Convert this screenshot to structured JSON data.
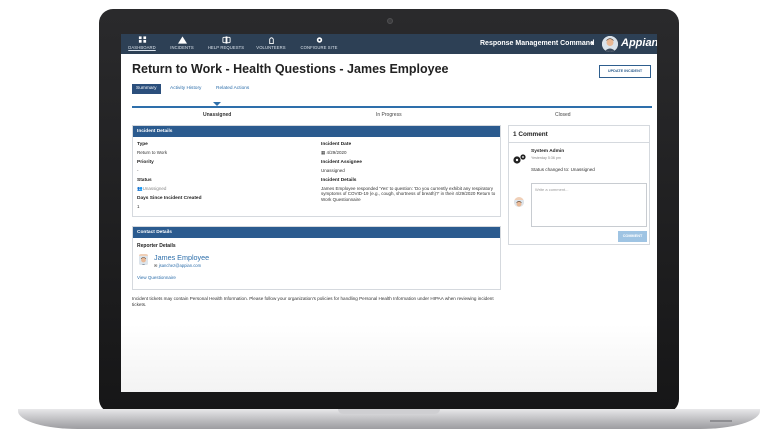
{
  "nav": {
    "items": [
      {
        "label": "DASHBOARD",
        "icon": "dashboard-icon"
      },
      {
        "label": "INCIDENTS",
        "icon": "warning-icon"
      },
      {
        "label": "HELP REQUESTS",
        "icon": "help-request-icon"
      },
      {
        "label": "VOLUNTEERS",
        "icon": "volunteer-icon"
      },
      {
        "label": "CONFIGURE SITE",
        "icon": "gear-icon"
      }
    ],
    "app_name": "Response Management Command",
    "logo": "Appian"
  },
  "header": {
    "title": "Return to Work - Health Questions - James Employee",
    "update_button": "UPDATE INCIDENT",
    "tabs": [
      "Summary",
      "Activity History",
      "Related Actions"
    ]
  },
  "status": {
    "steps": [
      "Unassigned",
      "In Progress",
      "Closed"
    ],
    "current": "Unassigned"
  },
  "incident_details": {
    "heading": "Incident Details",
    "type_label": "Type",
    "type_value": "Return to Work",
    "priority_label": "Priority",
    "priority_value": "-",
    "status_label": "Status",
    "status_value": "Unassigned",
    "days_label": "Days Since Incident Created",
    "days_value": "1",
    "date_label": "Incident Date",
    "date_value": "4/29/2020",
    "assignee_label": "Incident Assignee",
    "assignee_value": "Unassigned",
    "details_label": "Incident Details",
    "details_value": "James Employee responded 'Yes' to question: 'Do you currently exhibit any respiratory symptoms of COVID-19 (e.g., cough, shortness of breath)?' in their 4/29/2020 Return to Work Questionnaire"
  },
  "contact_details": {
    "heading": "Contact Details",
    "reporter_label": "Reporter Details",
    "name": "James Employee",
    "email": "jsanchez@appian.com",
    "questionnaire_link": "View Questionnaire"
  },
  "disclaimer": "Incident tickets may contain Personal Health Information.  Please follow your organization's policies for handling Personal Health Information under HIPAA when reviewing incident tickets.",
  "comments": {
    "count_label": "1 Comment",
    "author": "System Admin",
    "time": "Yesterday 5:36 pm",
    "text": "Status changed to: Unassigned",
    "placeholder": "Write a comment...",
    "button": "COMMENT"
  },
  "colors": {
    "nav_bg": "#2d4055",
    "panel_header": "#2b5b8f",
    "accent": "#2e6fab",
    "comment_button": "#9fc4e3"
  }
}
